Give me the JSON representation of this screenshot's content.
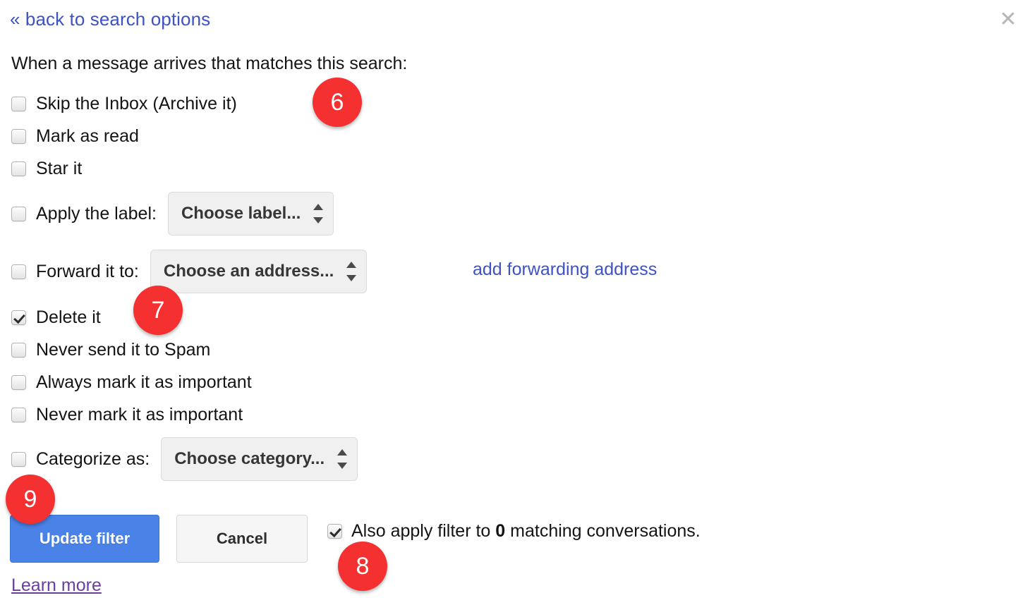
{
  "header": {
    "back_link": "« back to search options",
    "close_icon": "✕"
  },
  "heading": "When a message arrives that matches this search:",
  "options": [
    {
      "label": "Skip the Inbox (Archive it)",
      "checked": false
    },
    {
      "label": "Mark as read",
      "checked": false
    },
    {
      "label": "Star it",
      "checked": false
    },
    {
      "label": "Apply the label:",
      "checked": false,
      "select": "Choose label..."
    },
    {
      "label": "Forward it to:",
      "checked": false,
      "select": "Choose an address...",
      "link": "add forwarding address"
    },
    {
      "label": "Delete it",
      "checked": true
    },
    {
      "label": "Never send it to Spam",
      "checked": false
    },
    {
      "label": "Always mark it as important",
      "checked": false
    },
    {
      "label": "Never mark it as important",
      "checked": false
    },
    {
      "label": "Categorize as:",
      "checked": false,
      "select": "Choose category..."
    }
  ],
  "footer": {
    "update_button": "Update filter",
    "cancel_button": "Cancel",
    "apply_checked": true,
    "apply_text_before": "Also apply filter to",
    "apply_count": "0",
    "apply_text_after": "matching conversations.",
    "learn_more": "Learn more"
  },
  "badges": [
    {
      "number": "6"
    },
    {
      "number": "7"
    },
    {
      "number": "8"
    },
    {
      "number": "9"
    }
  ],
  "colors": {
    "link_blue": "#3d53c4",
    "primary_blue": "#4a82e8",
    "badge_red": "#f43030",
    "visited_purple": "#6a3fa0"
  }
}
